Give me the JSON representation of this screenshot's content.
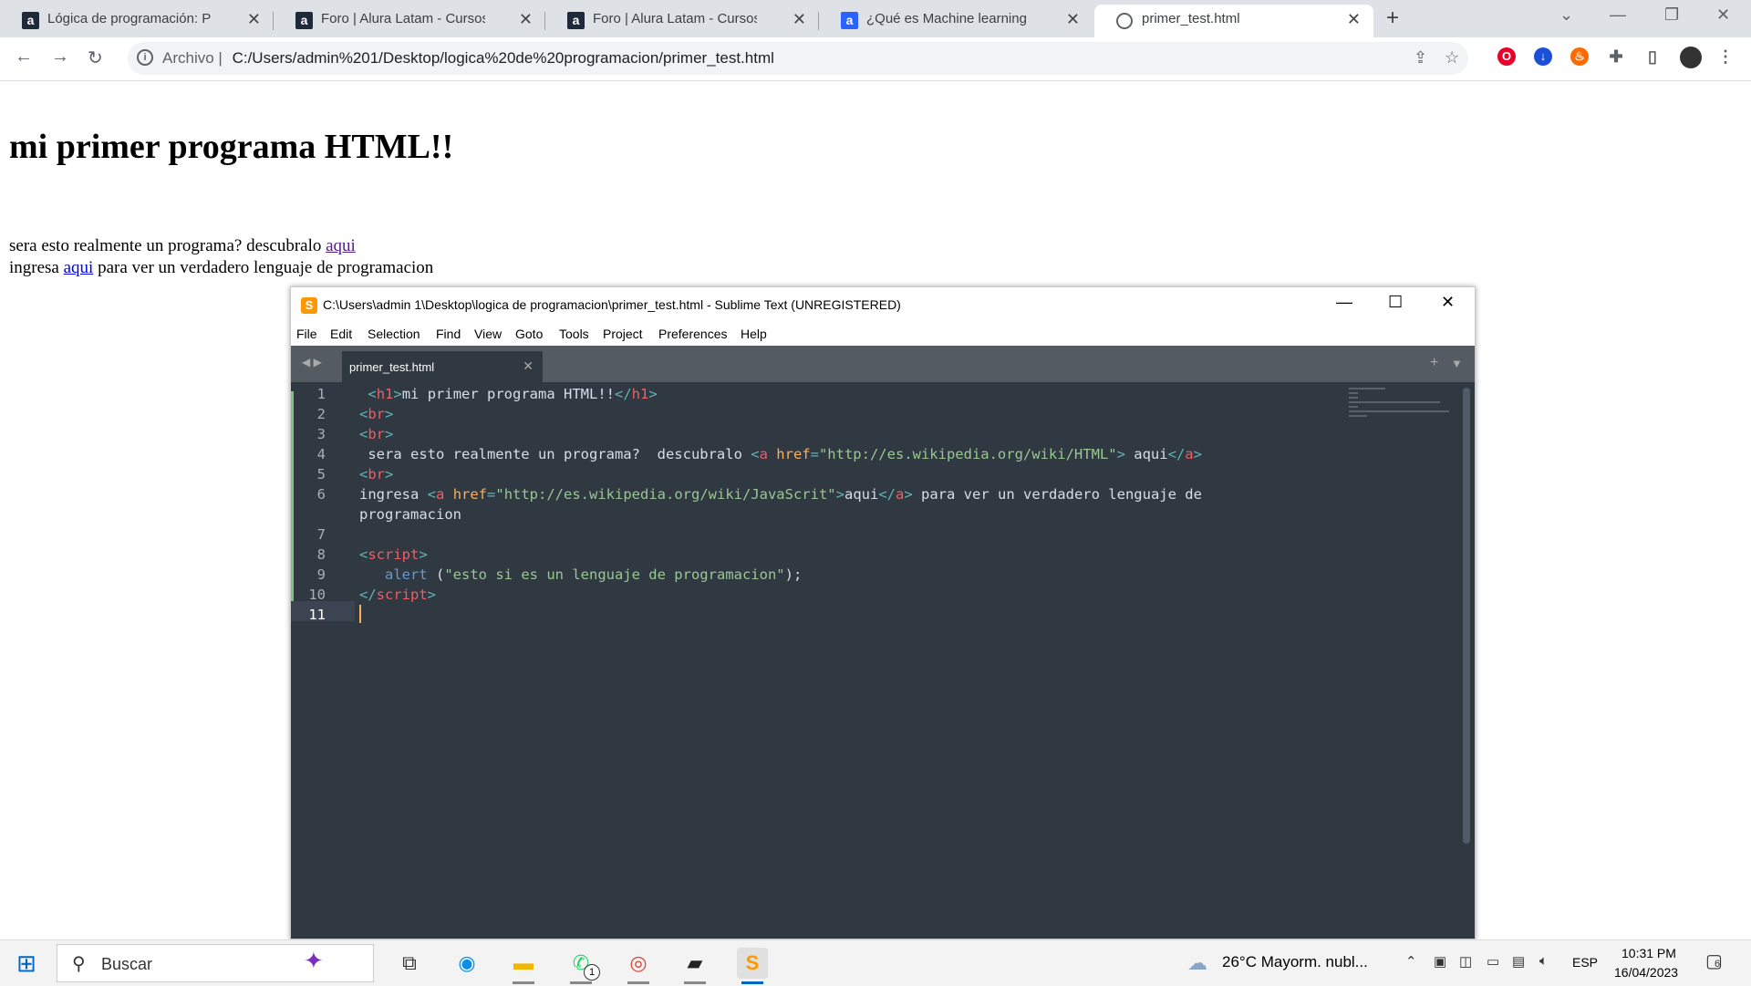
{
  "browser": {
    "tabs": [
      {
        "title": "Lógica de programación: Primero",
        "icon": "alura-icon",
        "active": false
      },
      {
        "title": "Foro | Alura Latam - Cursos online",
        "icon": "alura-icon",
        "active": false
      },
      {
        "title": "Foro | Alura Latam - Cursos online",
        "icon": "alura-icon",
        "active": false
      },
      {
        "title": "¿Qué es Machine learning | Alura",
        "icon": "alura-icon",
        "active": false
      },
      {
        "title": "primer_test.html",
        "icon": "globe-icon",
        "active": true
      }
    ],
    "address": {
      "prefix": "Archivo",
      "url": "C:/Users/admin%201/Desktop/logica%20de%20programacion/primer_test.html"
    }
  },
  "page": {
    "heading": "mi primer programa HTML!!",
    "line1_text": "sera esto realmente un programa? descubralo",
    "line1_link": "aqui",
    "line2_prefix": "ingresa",
    "line2_link": "aqui",
    "line2_suffix": "para ver un verdadero lenguaje de programacion"
  },
  "editor": {
    "title": "C:\\Users\\admin 1\\Desktop\\logica de programacion\\primer_test.html - Sublime Text (UNREGISTERED)",
    "menu": [
      "File",
      "Edit",
      "Selection",
      "Find",
      "View",
      "Goto",
      "Tools",
      "Project",
      "Preferences",
      "Help"
    ],
    "tab_name": "primer_test.html",
    "line_numbers": [
      "1",
      "2",
      "3",
      "4",
      "5",
      "6",
      "7",
      "8",
      "9",
      "10",
      "11"
    ],
    "code": {
      "l1_tag_open": "<h1>",
      "l1_text": "mi primer programa HTML!!",
      "l1_tag_close": "</h1>",
      "br": "<br>",
      "l4_text": " sera esto realmente un programa?  descubralo ",
      "l4_href_url": "\"http://es.wikipedia.org/wiki/HTML\"",
      "l4_link_text": " aqui",
      "l6_text": "ingresa ",
      "l6_href_url": "\"http://es.wikipedia.org/wiki/JavaScrit\"",
      "l6_link_text": "aqui",
      "l6_suffix": " para ver un verdadero lenguaje de",
      "l6_wrap": "programacion",
      "script_open": "script",
      "l9_fn": "alert",
      "l9_str": "\"esto si es un lenguaje de programacion\"",
      "l9_end": ");",
      "script_close": "script"
    }
  },
  "taskbar": {
    "search": "Buscar",
    "weather": "26°C  Mayorm. nubl...",
    "lang": "ESP",
    "time": "10:31 PM",
    "date": "16/04/2023",
    "notifications": "6",
    "whatsapp_badge": "1"
  },
  "colors": {
    "sublime_bg": "#303841",
    "tag": "#ec5f66",
    "string": "#99c794",
    "attr": "#f9ae58"
  }
}
